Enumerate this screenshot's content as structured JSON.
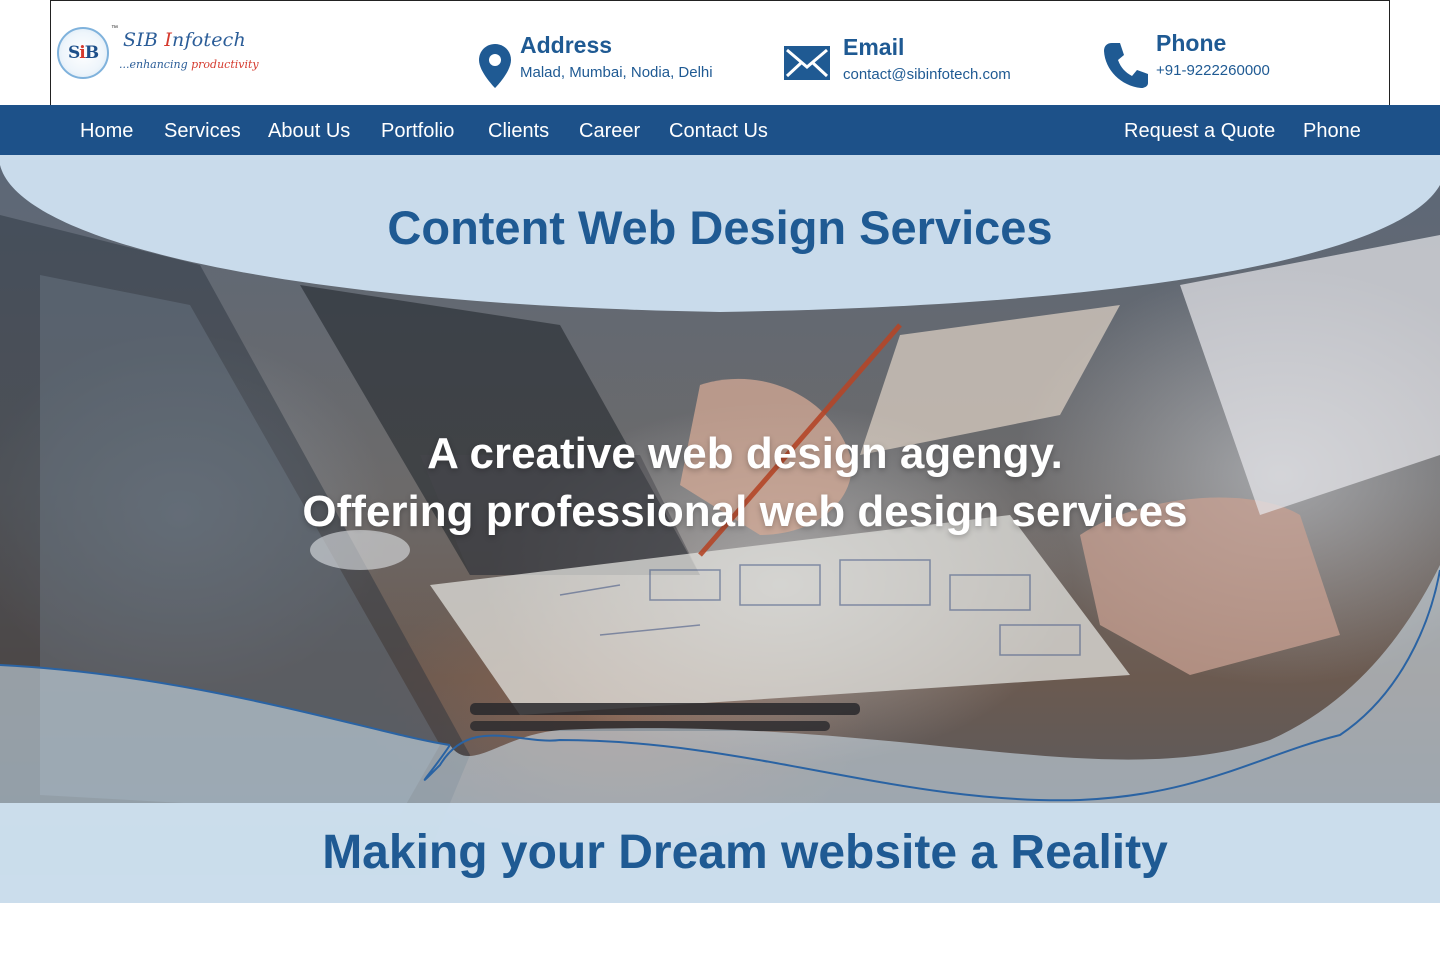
{
  "brand": {
    "name_part1": "SIB ",
    "name_initial": "I",
    "name_part2": "nfotech",
    "trademark": "™",
    "tagline_part1": "...enhancing ",
    "tagline_part2": "productivity",
    "mark_s": "S",
    "mark_i": "i",
    "mark_b": "B"
  },
  "contact": {
    "address": {
      "title": "Address",
      "value": "Malad, Mumbai, Nodia, Delhi",
      "icon": "map-pin-icon"
    },
    "email": {
      "title": "Email",
      "value": "contact@sibinfotech.com",
      "icon": "envelope-icon"
    },
    "phone": {
      "title": "Phone",
      "value": "+91-9222260000",
      "icon": "phone-icon"
    }
  },
  "nav": {
    "items": [
      "Home",
      "Services",
      "About Us",
      "Portfolio",
      "Clients",
      "Career",
      "Contact Us"
    ],
    "right": [
      "Request a Quote",
      "Phone"
    ]
  },
  "hero": {
    "title": "Content Web Design Services",
    "tagline_line1": "A creative web design agengy.",
    "tagline_line2": "Offering professional web design services",
    "bottom_title": "Making your Dream website a Reality"
  },
  "colors": {
    "brand_blue": "#1d5189",
    "text_blue": "#1f5a93",
    "brand_red": "#d53a2e",
    "light_overlay": "#cfe2f1"
  }
}
